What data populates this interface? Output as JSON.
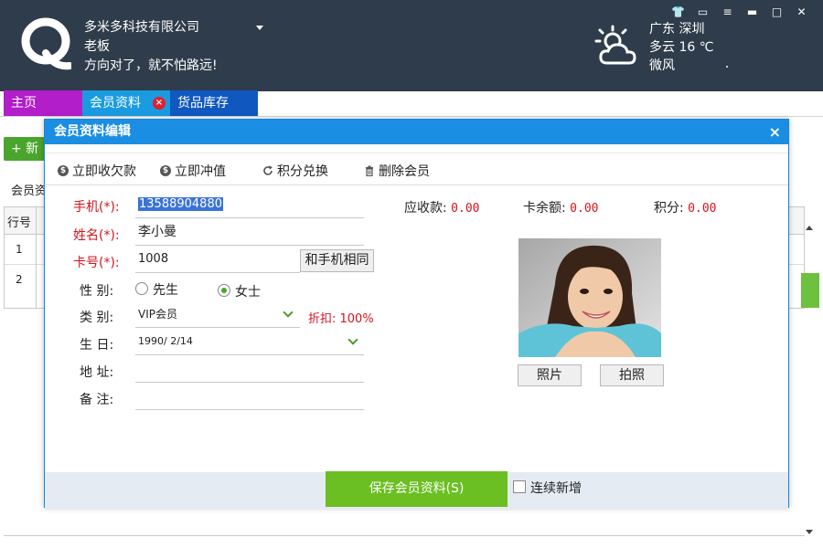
{
  "header": {
    "company_name": "多米多科技有限公司",
    "user_role": "老板",
    "slogan": "方向对了，就不怕路远!",
    "weather": {
      "location": "广东  深圳",
      "condition_temp": "多云  16 ℃",
      "wind": "微风"
    }
  },
  "tabs": [
    {
      "label": "主页",
      "color": "#b21ec9"
    },
    {
      "label": "会员资料",
      "color": "#1a9be0"
    },
    {
      "label": "货品库存",
      "color": "#1058c0"
    }
  ],
  "background_page": {
    "add_button_label": "+ 新",
    "crumb": "会员资",
    "table_header": "行号",
    "rows": [
      "1",
      "2"
    ]
  },
  "dialog": {
    "title": "会员资料编辑",
    "close_glyph": "×",
    "toolbar": [
      {
        "label": "立即收欠款",
        "icon": "dollar-circle-icon"
      },
      {
        "label": "立即冲值",
        "icon": "dollar-circle-icon"
      },
      {
        "label": "积分兑换",
        "icon": "refresh-icon"
      },
      {
        "label": "删除会员",
        "icon": "trash-icon"
      }
    ],
    "form": {
      "phone_label": "手机(*):",
      "phone_value": "13588904880",
      "name_label": "姓名(*):",
      "name_value": "李小曼",
      "card_label": "卡号(*):",
      "card_value": "1008",
      "same_as_phone_button": "和手机相同",
      "gender_label": "性   别:",
      "gender_options": [
        "先生",
        "女士"
      ],
      "gender_selected": "女士",
      "category_label": "类   别:",
      "category_value": "VIP会员",
      "discount_text": "折扣: 100%",
      "birthday_label": "生   日:",
      "birthday_value": "1990/ 2/14",
      "address_label": "地   址:",
      "address_value": "",
      "note_label": "备   注:",
      "note_value": ""
    },
    "stats": {
      "receivable_label": "应收款:",
      "receivable_value": "0.00",
      "card_balance_label": "卡余额:",
      "card_balance_value": "0.00",
      "points_label": "积分:",
      "points_value": "0.00"
    },
    "photo_buttons": {
      "photo": "照片",
      "take_photo": "拍照"
    },
    "footer": {
      "save_button": "保存会员资料(S)",
      "continuous_add_label": "连续新增",
      "continuous_add_checked": false
    }
  },
  "colors": {
    "header_bg": "#2f3c4b",
    "dialog_title_bg": "#1a8ee2",
    "save_green": "#6bbf22",
    "required_red": "#d4141c"
  }
}
